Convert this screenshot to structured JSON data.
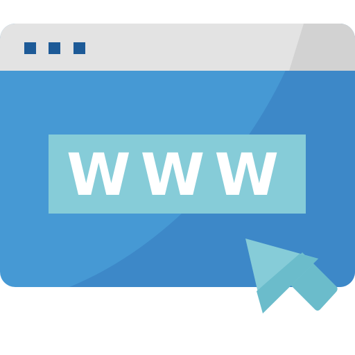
{
  "icon": {
    "name": "browser-window-www-icon",
    "address_text": "WWW",
    "colors": {
      "titlebar": "#e3e3e3",
      "titlebar_shade": "#d2d2d2",
      "window_body": "#4699d4",
      "window_shade": "#3d88c8",
      "titlebar_dots": "#1d5a97",
      "address_bar": "#86ccd8",
      "address_text": "#ffffff",
      "cursor_light": "#86ccd8",
      "cursor_dark": "#6bbccb"
    }
  }
}
